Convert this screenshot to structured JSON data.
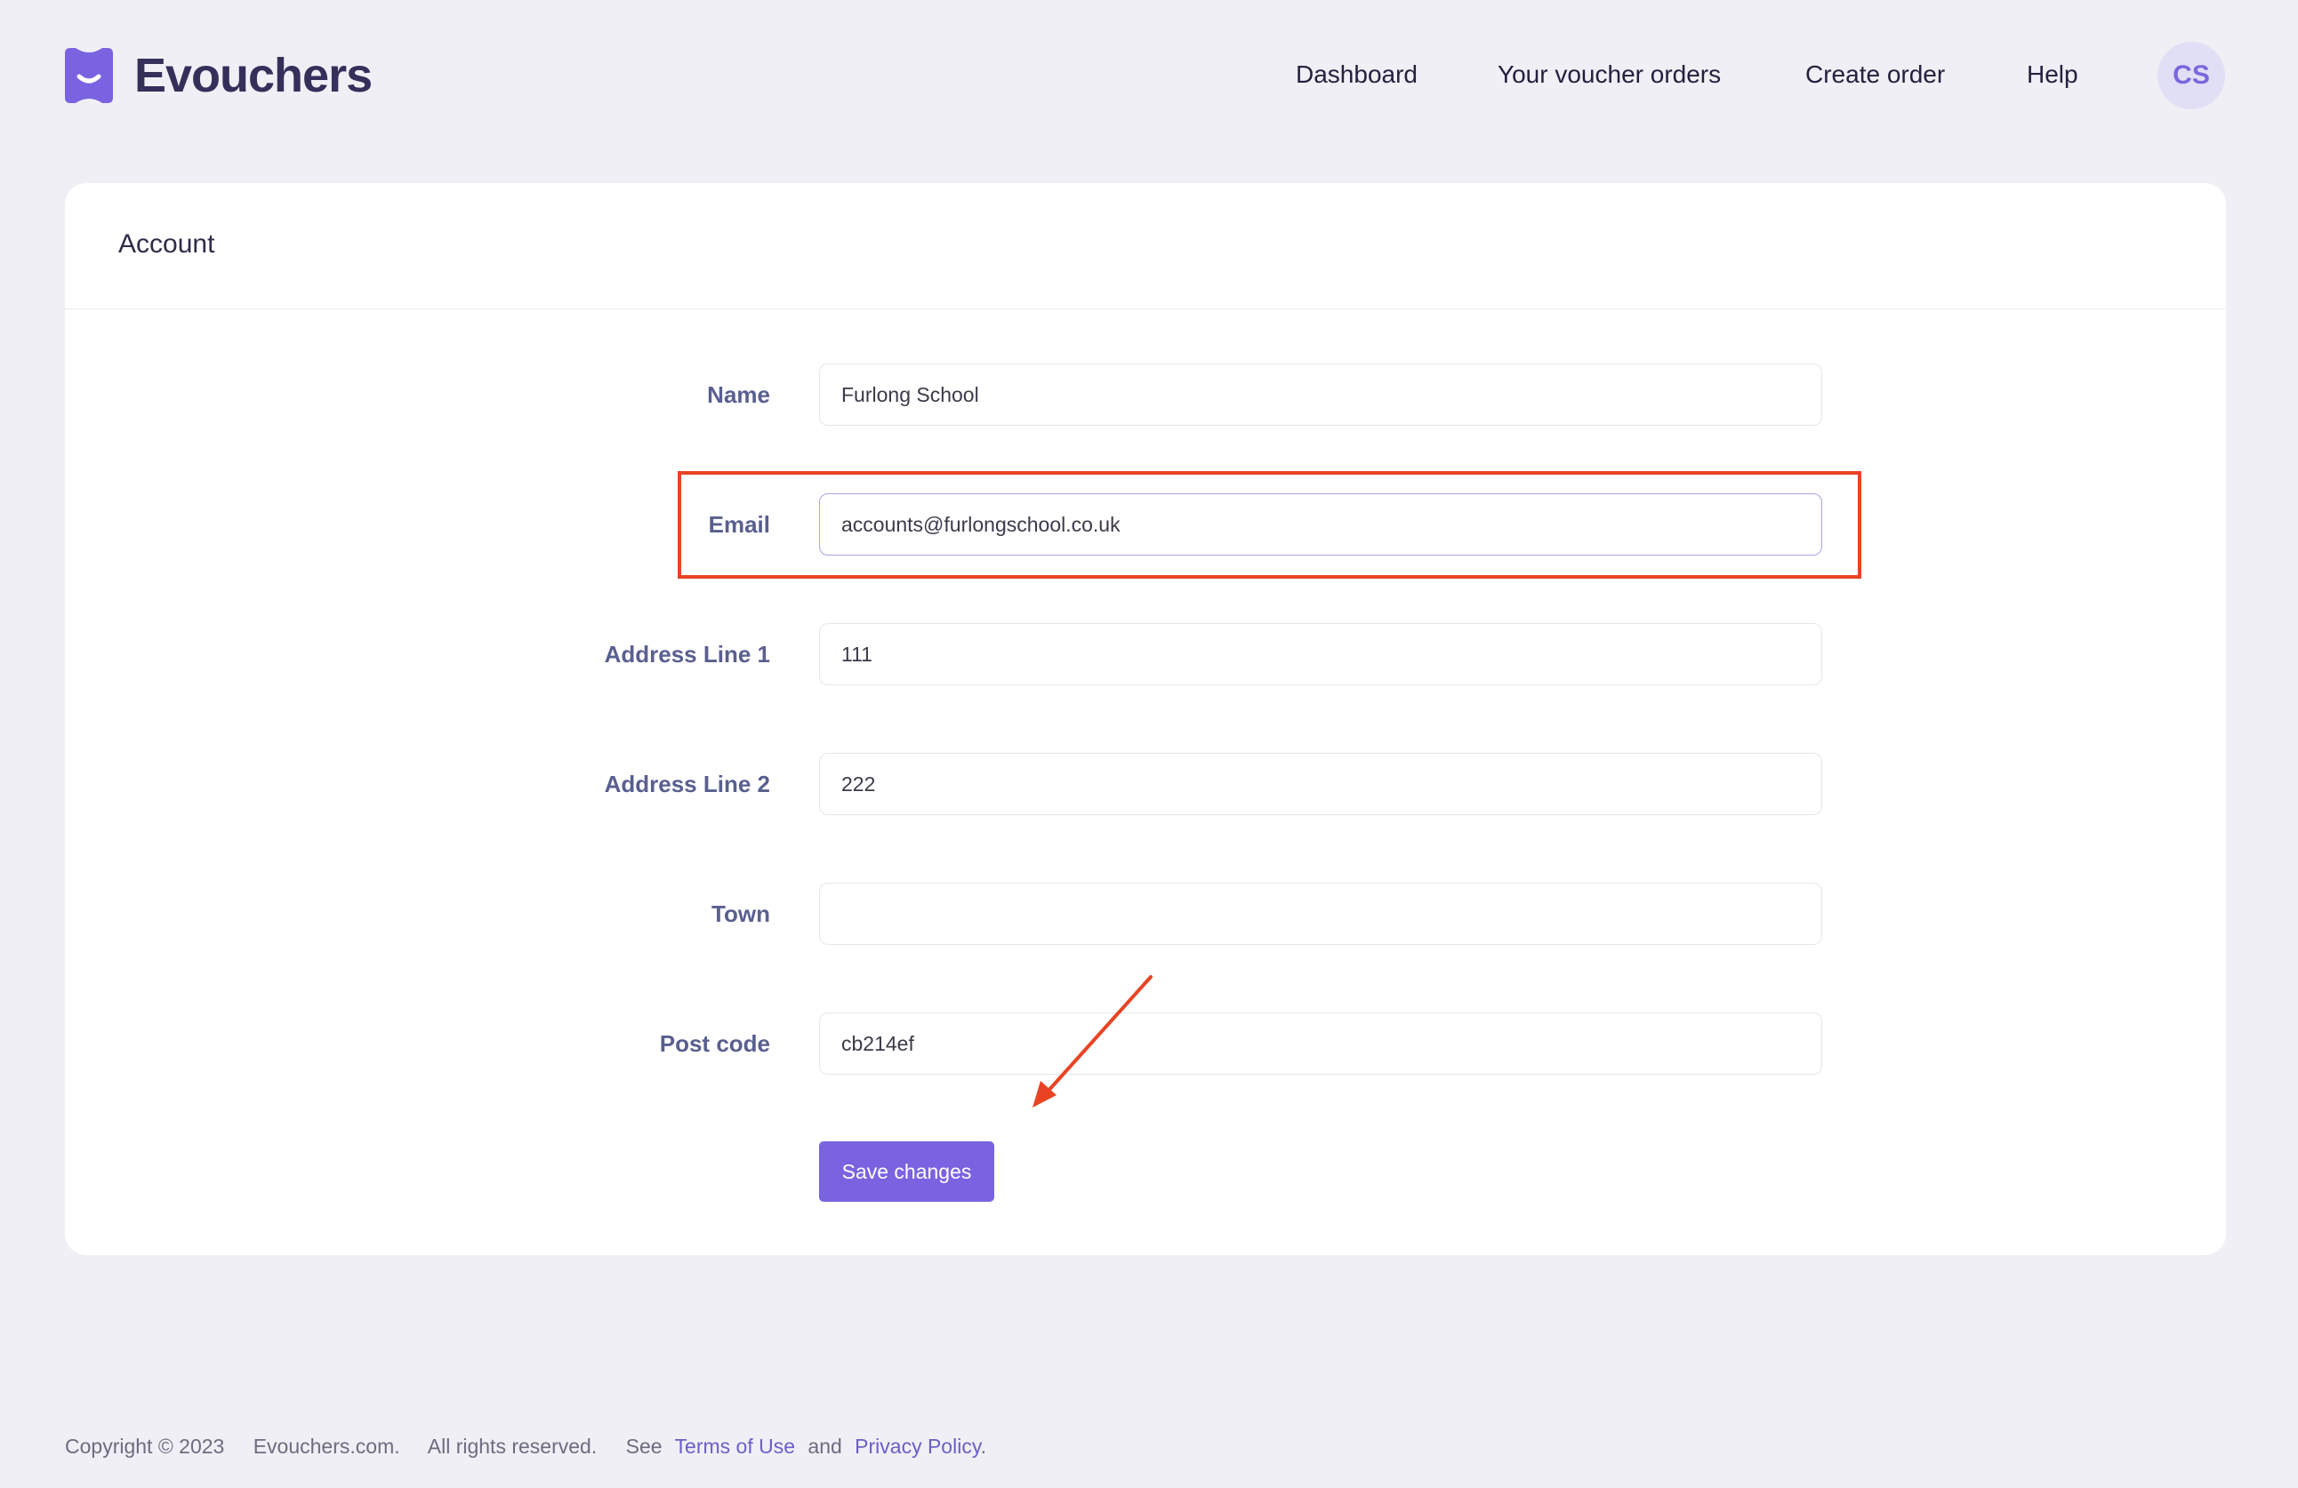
{
  "brand": {
    "name": "Evouchers",
    "color": "#7a63e0"
  },
  "nav": {
    "dashboard": "Dashboard",
    "orders": "Your voucher orders",
    "create": "Create order",
    "help": "Help",
    "avatar_initials": "CS"
  },
  "account": {
    "title": "Account",
    "fields": {
      "name": {
        "label": "Name",
        "value": "Furlong School"
      },
      "email": {
        "label": "Email",
        "value": "accounts@furlongschool.co.uk"
      },
      "address1": {
        "label": "Address Line 1",
        "value": "111"
      },
      "address2": {
        "label": "Address Line 2",
        "value": "222"
      },
      "town": {
        "label": "Town",
        "value": ""
      },
      "postcode": {
        "label": "Post code",
        "value": "cb214ef"
      }
    },
    "save_label": "Save changes"
  },
  "footer": {
    "copyright": "Copyright © 2023",
    "site": "Evouchers.com.",
    "rights": "All rights reserved.",
    "see": "See",
    "terms": "Terms of Use",
    "and": "and",
    "privacy": "Privacy Policy",
    "period": "."
  },
  "annotation_color": "#e84424"
}
